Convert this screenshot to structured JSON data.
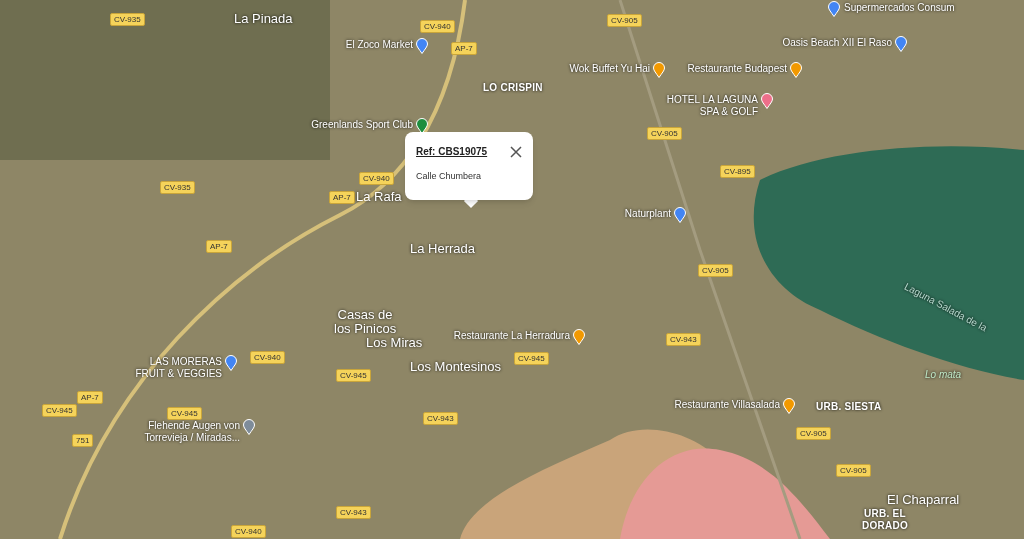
{
  "map": {
    "road_shields": [
      {
        "label": "CV-935"
      },
      {
        "label": "CV-940"
      },
      {
        "label": "AP-7"
      },
      {
        "label": "CV-905"
      },
      {
        "label": "CV-935"
      },
      {
        "label": "CV-940"
      },
      {
        "label": "AP-7"
      },
      {
        "label": "AP-7"
      },
      {
        "label": "CV-905"
      },
      {
        "label": "CV-895"
      },
      {
        "label": "CV-905"
      },
      {
        "label": "CV-940"
      },
      {
        "label": "CV-945"
      },
      {
        "label": "CV-945"
      },
      {
        "label": "CV-943"
      },
      {
        "label": "CV-945"
      },
      {
        "label": "AP-7"
      },
      {
        "label": "CV-945"
      },
      {
        "label": "751"
      },
      {
        "label": "CV-943"
      },
      {
        "label": "CV-905"
      },
      {
        "label": "CV-905"
      },
      {
        "label": "CV-943"
      },
      {
        "label": "CV-940"
      }
    ],
    "places": [
      {
        "label": "La Pinada",
        "kind": "town"
      },
      {
        "label": "LO CRISPIN",
        "kind": "district"
      },
      {
        "label": "La Rafa",
        "kind": "town"
      },
      {
        "label": "La Herrada",
        "kind": "town"
      },
      {
        "label": "Casas de\nlos Pinicos",
        "kind": "town"
      },
      {
        "label": "Los Miras",
        "kind": "town"
      },
      {
        "label": "Los Montesinos",
        "kind": "town"
      },
      {
        "label": "URB. SIESTA",
        "kind": "district"
      },
      {
        "label": "El Chaparral",
        "kind": "town"
      },
      {
        "label": "URB. EL\nDORADO",
        "kind": "district"
      },
      {
        "label": "Laguna Salada de la",
        "kind": "water"
      },
      {
        "label": "Lo mata",
        "kind": "park"
      }
    ],
    "pois": [
      {
        "label": "Supermercados Consum",
        "color": "#4285f4"
      },
      {
        "label": "El Zoco Market",
        "color": "#4285f4"
      },
      {
        "label": "Oasis Beach XII El Raso",
        "color": "#4285f4"
      },
      {
        "label": "Wok Buffet Yu Hai",
        "color": "#f29900"
      },
      {
        "label": "Restaurante Budapest",
        "color": "#f29900"
      },
      {
        "label": "HOTEL LA LAGUNA\nSPA & GOLF",
        "color": "#ee6f8a"
      },
      {
        "label": "Greenlands Sport Club",
        "color": "#1e8e3e"
      },
      {
        "label": "Naturplant",
        "color": "#4285f4"
      },
      {
        "label": "Restaurante La Herradura",
        "color": "#f29900"
      },
      {
        "label": "LAS MORERAS\nFRUIT & VEGGIES",
        "color": "#4285f4"
      },
      {
        "label": "Restaurante Villasalada",
        "color": "#f29900"
      },
      {
        "label": "Flehende Augen von\nTorrevieja / Miradas...",
        "color": "#7e8c9a"
      }
    ],
    "popup": {
      "title": "Ref: CBS19075",
      "address": "Calle Chumbera"
    }
  }
}
